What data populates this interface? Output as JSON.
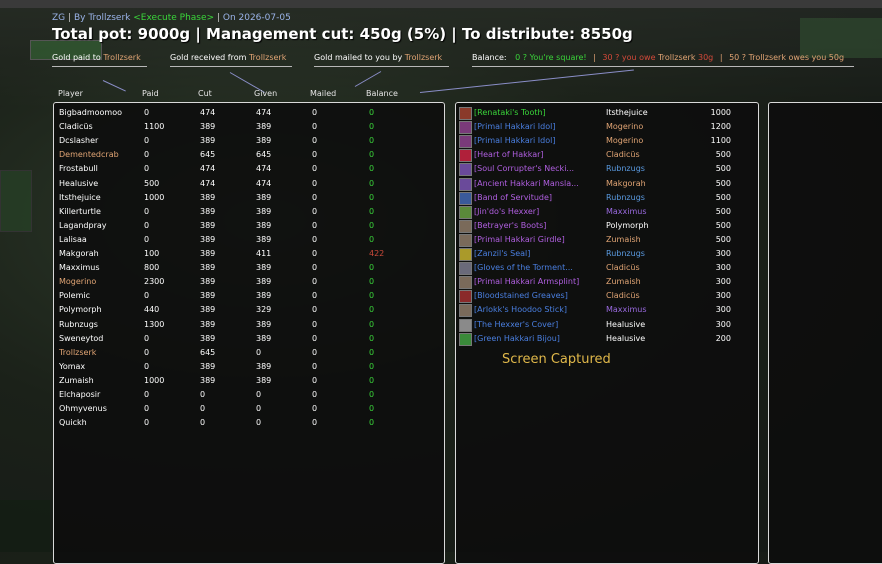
{
  "header": {
    "line1": {
      "raid": "ZG",
      "by": "By",
      "author": "Trollzserk",
      "phase": "<Execute Phase>",
      "sep": "|",
      "on": "On 2026-07-05"
    },
    "title": "Total pot: 9000g | Management cut: 450g (5%) | To distribute: 8550g"
  },
  "legend": {
    "paid_prefix": "Gold paid to",
    "paid_name": "Trollzserk",
    "received_prefix": "Gold received from",
    "received_name": "Trollzserk",
    "mailed_prefix": "Gold mailed to you by",
    "mailed_name": "Trollzserk",
    "balance_label": "Balance:",
    "square": "0 ? You're square!",
    "sep": "|",
    "owe_pre": "30 ? you owe",
    "owe_name": "Trollzserk",
    "owe_amt": "30g",
    "owes_pre": "50 ? Trollzserk owes you 50g"
  },
  "columns": [
    "Player",
    "Paid",
    "Cut",
    "Given",
    "Mailed",
    "Balance"
  ],
  "players": [
    {
      "name": "Bigbadmoomoo",
      "paid": "0",
      "cut": "474",
      "given": "474",
      "mailed": "0",
      "balance": "0",
      "hl": false,
      "neg": false
    },
    {
      "name": "Cladicüs",
      "paid": "1100",
      "cut": "389",
      "given": "389",
      "mailed": "0",
      "balance": "0",
      "hl": false,
      "neg": false
    },
    {
      "name": "Dcslasher",
      "paid": "0",
      "cut": "389",
      "given": "389",
      "mailed": "0",
      "balance": "0",
      "hl": false,
      "neg": false
    },
    {
      "name": "Dementedcrab",
      "paid": "0",
      "cut": "645",
      "given": "645",
      "mailed": "0",
      "balance": "0",
      "hl": true,
      "neg": false
    },
    {
      "name": "Frostabull",
      "paid": "0",
      "cut": "474",
      "given": "474",
      "mailed": "0",
      "balance": "0",
      "hl": false,
      "neg": false
    },
    {
      "name": "Healusive",
      "paid": "500",
      "cut": "474",
      "given": "474",
      "mailed": "0",
      "balance": "0",
      "hl": false,
      "neg": false
    },
    {
      "name": "Itsthejuice",
      "paid": "1000",
      "cut": "389",
      "given": "389",
      "mailed": "0",
      "balance": "0",
      "hl": false,
      "neg": false
    },
    {
      "name": "Killerturtle",
      "paid": "0",
      "cut": "389",
      "given": "389",
      "mailed": "0",
      "balance": "0",
      "hl": false,
      "neg": false
    },
    {
      "name": "Lagandpray",
      "paid": "0",
      "cut": "389",
      "given": "389",
      "mailed": "0",
      "balance": "0",
      "hl": false,
      "neg": false
    },
    {
      "name": "Lalisaa",
      "paid": "0",
      "cut": "389",
      "given": "389",
      "mailed": "0",
      "balance": "0",
      "hl": false,
      "neg": false
    },
    {
      "name": "Makgorah",
      "paid": "100",
      "cut": "389",
      "given": "411",
      "mailed": "0",
      "balance": "422",
      "hl": false,
      "neg": true
    },
    {
      "name": "Maxximus",
      "paid": "800",
      "cut": "389",
      "given": "389",
      "mailed": "0",
      "balance": "0",
      "hl": false,
      "neg": false
    },
    {
      "name": "Mogerino",
      "paid": "2300",
      "cut": "389",
      "given": "389",
      "mailed": "0",
      "balance": "0",
      "hl": true,
      "neg": false
    },
    {
      "name": "Polemic",
      "paid": "0",
      "cut": "389",
      "given": "389",
      "mailed": "0",
      "balance": "0",
      "hl": false,
      "neg": false
    },
    {
      "name": "Polymorph",
      "paid": "440",
      "cut": "389",
      "given": "329",
      "mailed": "0",
      "balance": "0",
      "hl": false,
      "neg": false
    },
    {
      "name": "Rubnzugs",
      "paid": "1300",
      "cut": "389",
      "given": "389",
      "mailed": "0",
      "balance": "0",
      "hl": false,
      "neg": false
    },
    {
      "name": "Sweneytod",
      "paid": "0",
      "cut": "389",
      "given": "389",
      "mailed": "0",
      "balance": "0",
      "hl": false,
      "neg": false
    },
    {
      "name": "Trollzserk",
      "paid": "0",
      "cut": "645",
      "given": "0",
      "mailed": "0",
      "balance": "0",
      "hl": true,
      "neg": false
    },
    {
      "name": "Yomax",
      "paid": "0",
      "cut": "389",
      "given": "389",
      "mailed": "0",
      "balance": "0",
      "hl": false,
      "neg": false
    },
    {
      "name": "Zumaish",
      "paid": "1000",
      "cut": "389",
      "given": "389",
      "mailed": "0",
      "balance": "0",
      "hl": false,
      "neg": false
    },
    {
      "name": "Elchaposir",
      "paid": "0",
      "cut": "0",
      "given": "0",
      "mailed": "0",
      "balance": "0",
      "hl": false,
      "neg": false
    },
    {
      "name": "Ohmyvenus",
      "paid": "0",
      "cut": "0",
      "given": "0",
      "mailed": "0",
      "balance": "0",
      "hl": false,
      "neg": false
    },
    {
      "name": "Quickh",
      "paid": "0",
      "cut": "0",
      "given": "0",
      "mailed": "0",
      "balance": "0",
      "hl": false,
      "neg": false
    }
  ],
  "loot": [
    {
      "item": "[Renataki's Tooth]",
      "quality": "uncommon",
      "winner": "Itsthejuice",
      "wcolor": "white",
      "price": "1000",
      "icon_color": "#8a3a2a"
    },
    {
      "item": "[Primal Hakkari Idol]",
      "quality": "rare",
      "winner": "Mogerino",
      "wcolor": "orange",
      "price": "1200",
      "icon_color": "#7a3a7a"
    },
    {
      "item": "[Primal Hakkari Idol]",
      "quality": "rare",
      "winner": "Mogerino",
      "wcolor": "orange",
      "price": "1100",
      "icon_color": "#7a3a7a"
    },
    {
      "item": "[Heart of Hakkar]",
      "quality": "epic",
      "winner": "Cladicüs",
      "wcolor": "orange",
      "price": "500",
      "icon_color": "#b0203a"
    },
    {
      "item": "[Soul Corrupter's Necki...",
      "quality": "epic",
      "winner": "Rubnzugs",
      "wcolor": "blue",
      "price": "500",
      "icon_color": "#6a4a9a"
    },
    {
      "item": "[Ancient Hakkari Mansla...",
      "quality": "epic",
      "winner": "Makgorah",
      "wcolor": "orange",
      "price": "500",
      "icon_color": "#6a4a9a"
    },
    {
      "item": "[Band of Servitude]",
      "quality": "epic",
      "winner": "Rubnzugs",
      "wcolor": "blue",
      "price": "500",
      "icon_color": "#3a5a9a"
    },
    {
      "item": "[Jin'do's Hexxer]",
      "quality": "epic",
      "winner": "Maxximus",
      "wcolor": "purple",
      "price": "500",
      "icon_color": "#5a8a3a"
    },
    {
      "item": "[Betrayer's Boots]",
      "quality": "epic",
      "winner": "Polymorph",
      "wcolor": "white",
      "price": "500",
      "icon_color": "#7a6a5a"
    },
    {
      "item": "[Primal Hakkari Girdle]",
      "quality": "epic",
      "winner": "Zumaish",
      "wcolor": "orange",
      "price": "500",
      "icon_color": "#7a6a5a"
    },
    {
      "item": "[Zanzil's Seal]",
      "quality": "rare",
      "winner": "Rubnzugs",
      "wcolor": "blue",
      "price": "300",
      "icon_color": "#aa9a2a"
    },
    {
      "item": "[Gloves of the Torment...",
      "quality": "rare",
      "winner": "Cladicüs",
      "wcolor": "orange",
      "price": "300",
      "icon_color": "#6a6a7a"
    },
    {
      "item": "[Primal Hakkari Armsplint]",
      "quality": "epic",
      "winner": "Zumaish",
      "wcolor": "orange",
      "price": "300",
      "icon_color": "#7a6a5a"
    },
    {
      "item": "[Bloodstained Greaves]",
      "quality": "rare",
      "winner": "Cladicüs",
      "wcolor": "orange",
      "price": "300",
      "icon_color": "#8a2a2a"
    },
    {
      "item": "[Arlokk's Hoodoo Stick]",
      "quality": "rare",
      "winner": "Maxximus",
      "wcolor": "purple",
      "price": "300",
      "icon_color": "#7a6a5a"
    },
    {
      "item": "[The Hexxer's Cover]",
      "quality": "rare",
      "winner": "Healusive",
      "wcolor": "white",
      "price": "300",
      "icon_color": "#8a8a8a"
    },
    {
      "item": "[Green Hakkari Bijou]",
      "quality": "rare",
      "winner": "Healusive",
      "wcolor": "white",
      "price": "200",
      "icon_color": "#3a8a3a"
    }
  ],
  "overlay": {
    "captured": "Screen Captured"
  }
}
